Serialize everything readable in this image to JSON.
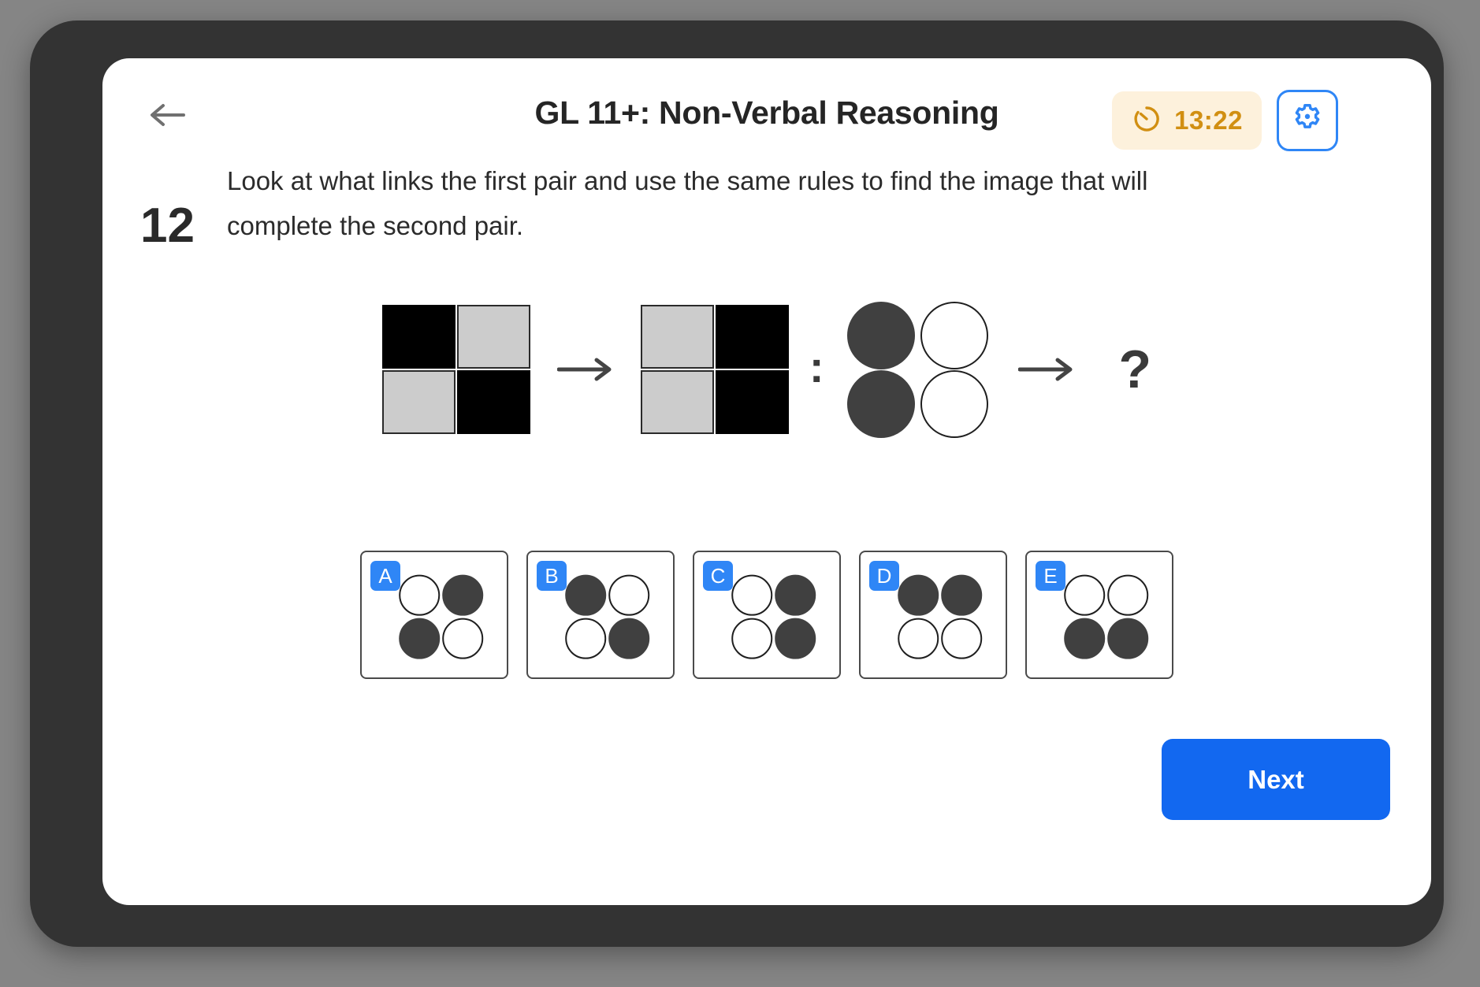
{
  "header": {
    "back_icon": "arrow-left-icon",
    "title": "GL 11+: Non-Verbal Reasoning",
    "timer": {
      "icon": "timer-icon",
      "value": "13:22",
      "bg_color": "#fdf1dc",
      "text_color": "#d18f12"
    },
    "settings": {
      "icon": "gear-icon",
      "accent_color": "#2f86f6"
    }
  },
  "question": {
    "number": "12",
    "text": "Look at what links the first pair and use the same rules to find the image that will complete the second pair."
  },
  "stimulus": {
    "arrow_glyph": "→",
    "colon_glyph": ":",
    "question_glyph": "?",
    "pair_one": {
      "left": {
        "type": "squares",
        "cells": [
          "black",
          "gray",
          "gray",
          "black"
        ]
      },
      "right": {
        "type": "squares",
        "cells": [
          "gray",
          "black",
          "gray",
          "black"
        ]
      }
    },
    "pair_two": {
      "left": {
        "type": "circles",
        "cells": [
          "dark",
          "white",
          "dark",
          "white"
        ]
      },
      "right": {
        "type": "unknown"
      }
    },
    "colors": {
      "black": "#000000",
      "gray": "#cccccc",
      "dark_circle": "#404040",
      "white_circle": "#ffffff"
    }
  },
  "options": [
    {
      "label": "A",
      "cells": [
        "white",
        "dark",
        "dark",
        "white"
      ]
    },
    {
      "label": "B",
      "cells": [
        "dark",
        "white",
        "white",
        "dark"
      ]
    },
    {
      "label": "C",
      "cells": [
        "white",
        "dark",
        "white",
        "dark"
      ]
    },
    {
      "label": "D",
      "cells": [
        "dark",
        "dark",
        "white",
        "white"
      ]
    },
    {
      "label": "E",
      "cells": [
        "white",
        "white",
        "dark",
        "dark"
      ]
    }
  ],
  "footer": {
    "next_label": "Next",
    "next_color": "#1268f0"
  }
}
